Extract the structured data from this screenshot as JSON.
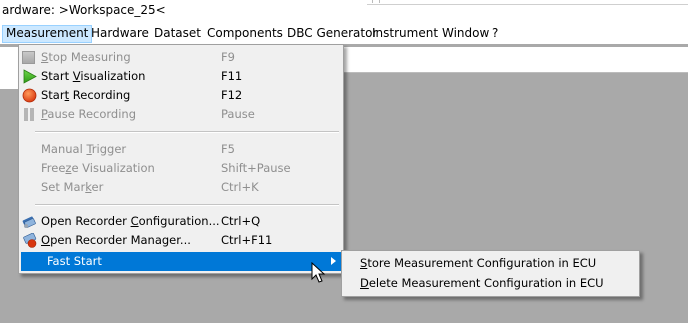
{
  "window": {
    "title_text": "ardware: >Workspace_25<"
  },
  "menubar": {
    "items": [
      {
        "label": "Measurement",
        "active": true
      },
      {
        "label": "Hardware"
      },
      {
        "label": "Dataset"
      },
      {
        "label": "Components"
      },
      {
        "label": "DBC Generator"
      },
      {
        "label": "Instrument"
      },
      {
        "label": "Window"
      },
      {
        "label": "?"
      }
    ]
  },
  "measurement_menu": {
    "stop_measuring": {
      "pre": "",
      "mnemonic": "S",
      "post": "top Measuring",
      "shortcut": "F9",
      "disabled": true,
      "icon": "stop-square-icon"
    },
    "start_visualization": {
      "pre": "Start ",
      "mnemonic": "V",
      "post": "isualization",
      "shortcut": "F11",
      "icon": "play-triangle-icon"
    },
    "start_recording": {
      "pre": "Star",
      "mnemonic": "t",
      "post": " Recording",
      "shortcut": "F12",
      "icon": "record-circle-icon"
    },
    "pause_recording": {
      "pre": "",
      "mnemonic": "P",
      "post": "ause Recording",
      "shortcut": "Pause",
      "disabled": true,
      "icon": "pause-bars-icon"
    },
    "manual_trigger": {
      "pre": "Manual ",
      "mnemonic": "T",
      "post": "rigger",
      "shortcut": "F5",
      "disabled": true
    },
    "freeze_visualization": {
      "pre": "Free",
      "mnemonic": "z",
      "post": "e Visualization",
      "shortcut": "Shift+Pause",
      "disabled": true
    },
    "set_marker": {
      "pre": "Set Mar",
      "mnemonic": "k",
      "post": "er",
      "shortcut": "Ctrl+K",
      "disabled": true
    },
    "open_recorder_configuration": {
      "pre": "Open Recorder ",
      "mnemonic": "C",
      "post": "onfiguration...",
      "shortcut": "Ctrl+Q",
      "icon": "recorder-config-icon"
    },
    "open_recorder_manager": {
      "pre": "",
      "mnemonic": "O",
      "post": "pen Recorder Manager...",
      "shortcut": "Ctrl+F11",
      "icon": "recorder-manager-icon"
    },
    "fast_start": {
      "label": "Fast Start",
      "highlighted": true,
      "has_submenu": true
    }
  },
  "fast_start_submenu": {
    "store": {
      "pre": "",
      "mnemonic": "S",
      "post": "tore Measurement Configuration in ECU"
    },
    "delete": {
      "pre": "",
      "mnemonic": "D",
      "post": "elete Measurement Configuration in ECU"
    }
  },
  "colors": {
    "highlight": "#0078d7",
    "menubar_active": "#cce8ff",
    "disabled_text": "#8f8f8f",
    "workspace": "#a9a9a9",
    "menu_background": "#f0f0f0"
  }
}
